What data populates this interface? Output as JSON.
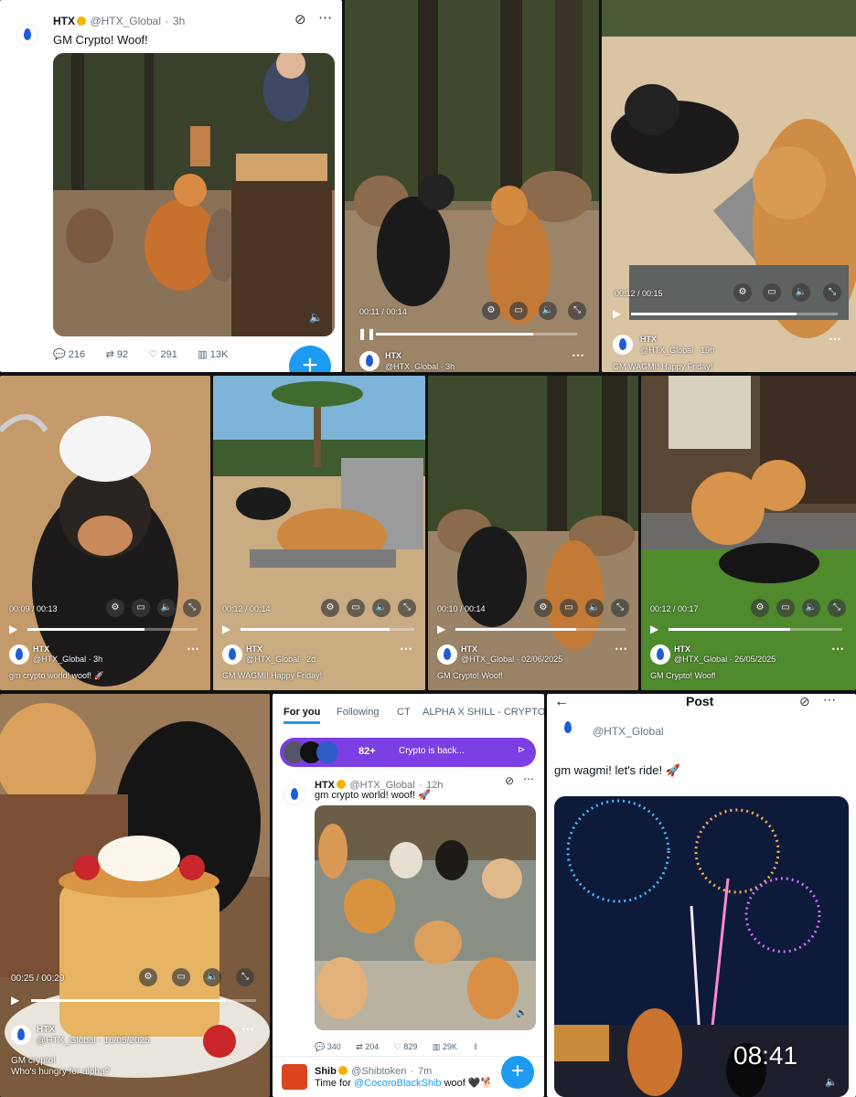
{
  "tile1": {
    "name": "HTX",
    "handle": "@HTX_Global",
    "time": "3h",
    "text": "GM Crypto! Woof!",
    "stats": {
      "replies": "216",
      "reposts": "92",
      "likes": "291",
      "views": "13K"
    }
  },
  "tile2": {
    "time_display": "00:11 / 00:14",
    "name": "HTX",
    "handle_time": "@HTX_Global · 3h",
    "progress": 0.78
  },
  "tile3": {
    "time_display": "00:12 / 00:15",
    "name": "HTX",
    "handle_time": "@HTX_Global · 19h",
    "text": "GM WAGMI! Happy Friday!",
    "progress": 0.8
  },
  "tile4": {
    "time_display": "00:09 / 00:13",
    "name": "HTX",
    "handle_time": "@HTX_Global · 3h",
    "text": "gm crypto world!  woof! 🚀",
    "progress": 0.69
  },
  "tile5": {
    "time_display": "00:12 / 00:14",
    "name": "HTX",
    "handle_time": "@HTX_Global · 2d",
    "text": "GM WAGMI! Happy Friday!",
    "progress": 0.86
  },
  "tile6": {
    "time_display": "00:10 / 00:14",
    "name": "HTX",
    "handle_time": "@HTX_Global · 02/06/2025",
    "text": "GM Crypto! Woof!",
    "progress": 0.71
  },
  "tile7": {
    "time_display": "00:12 / 00:17",
    "name": "HTX",
    "handle_time": "@HTX_Global · 26/05/2025",
    "text": "GM Crypto! Woof!",
    "progress": 0.7
  },
  "tile8": {
    "time_display": "00:25 / 00:29",
    "name": "HTX",
    "handle_time": "@HTX_Global · 16/05/2025",
    "text1": "GM crypto!",
    "text2": "Who's hungry for alpha?",
    "progress": 0.86
  },
  "tile9": {
    "tabs": [
      "For you",
      "Following",
      "CT",
      "ALPHA X SHILL - CRYPTO"
    ],
    "banner_count": "82+",
    "banner_text": "Crypto is back...",
    "name": "HTX",
    "handle": "@HTX_Global",
    "time": "12h",
    "text": "gm crypto world!  woof! 🚀",
    "stats": {
      "replies": "340",
      "reposts": "204",
      "likes": "829",
      "views": "29K"
    },
    "next_name": "Shib",
    "next_handle": "@Shibtoken",
    "next_time": "7m",
    "next_text_pre": "Time for ",
    "next_mention": "@CocoroBlackShib",
    "next_text_post": " woof 🖤🐕"
  },
  "tile10": {
    "header": "Post",
    "handle": "@HTX_Global",
    "text": "gm wagmi! let's ride! 🚀",
    "timestamp": "08:41"
  },
  "colors": {
    "brand_blue": "#1d9bf0",
    "purple_banner": "#7b3fe4"
  }
}
